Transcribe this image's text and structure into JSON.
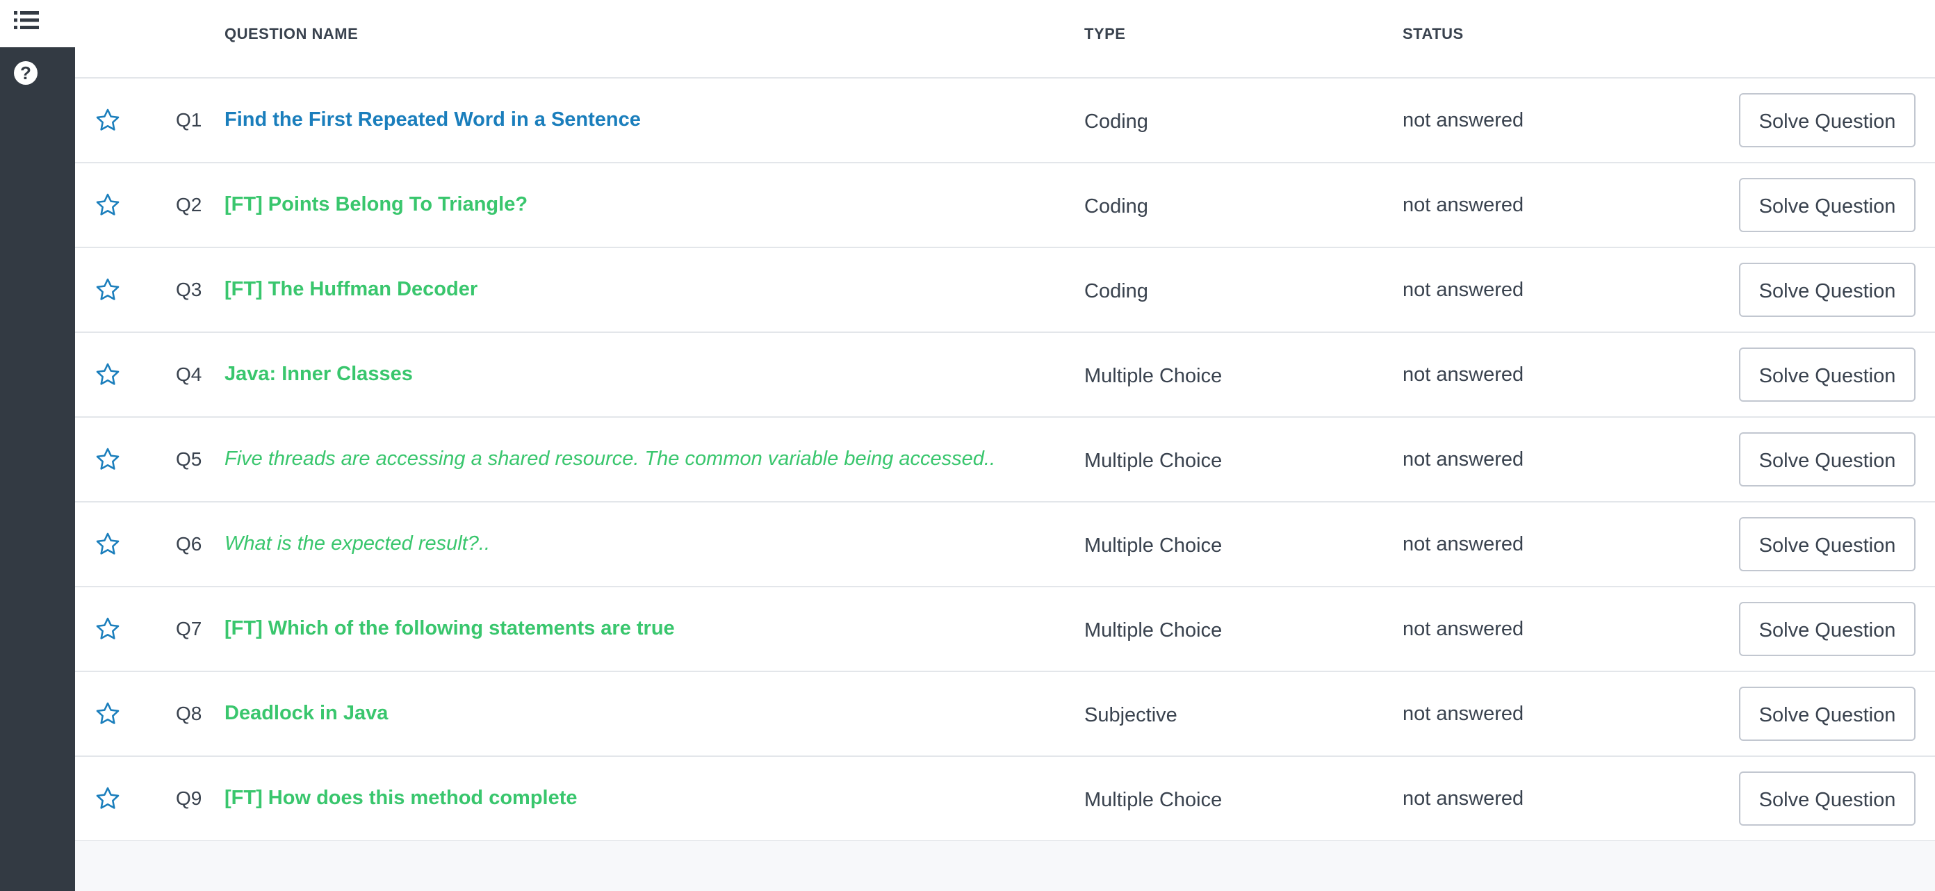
{
  "headers": {
    "question_name": "QUESTION NAME",
    "type": "TYPE",
    "status": "STATUS"
  },
  "icons": {
    "menu": "list-icon",
    "help": "help-icon",
    "star": "star-outline-icon"
  },
  "colors": {
    "sidebar": "#333a43",
    "link_blue": "#1a7ebc",
    "link_green": "#39c66d",
    "star_blue": "#1a7ebc"
  },
  "button_label": "Solve Question",
  "questions": [
    {
      "num": "Q1",
      "name": "Find the First Repeated Word in a Sentence",
      "type": "Coding",
      "status": "not answered"
    },
    {
      "num": "Q2",
      "name": "[FT] Points Belong To Triangle?",
      "type": "Coding",
      "status": "not answered"
    },
    {
      "num": "Q3",
      "name": "[FT] The Huffman Decoder",
      "type": "Coding",
      "status": "not answered"
    },
    {
      "num": "Q4",
      "name": "Java: Inner Classes",
      "type": "Multiple Choice",
      "status": "not answered"
    },
    {
      "num": "Q5",
      "name": "Five threads are accessing a shared resource. The common variable being accessed..",
      "type": "Multiple Choice",
      "status": "not answered"
    },
    {
      "num": "Q6",
      "name": "What is the expected result?..",
      "type": "Multiple Choice",
      "status": "not answered"
    },
    {
      "num": "Q7",
      "name": "[FT] Which of the following statements are true",
      "type": "Multiple Choice",
      "status": "not answered"
    },
    {
      "num": "Q8",
      "name": "Deadlock in Java",
      "type": "Subjective",
      "status": "not answered"
    },
    {
      "num": "Q9",
      "name": "[FT] How does this method complete",
      "type": "Multiple Choice",
      "status": "not answered"
    }
  ]
}
